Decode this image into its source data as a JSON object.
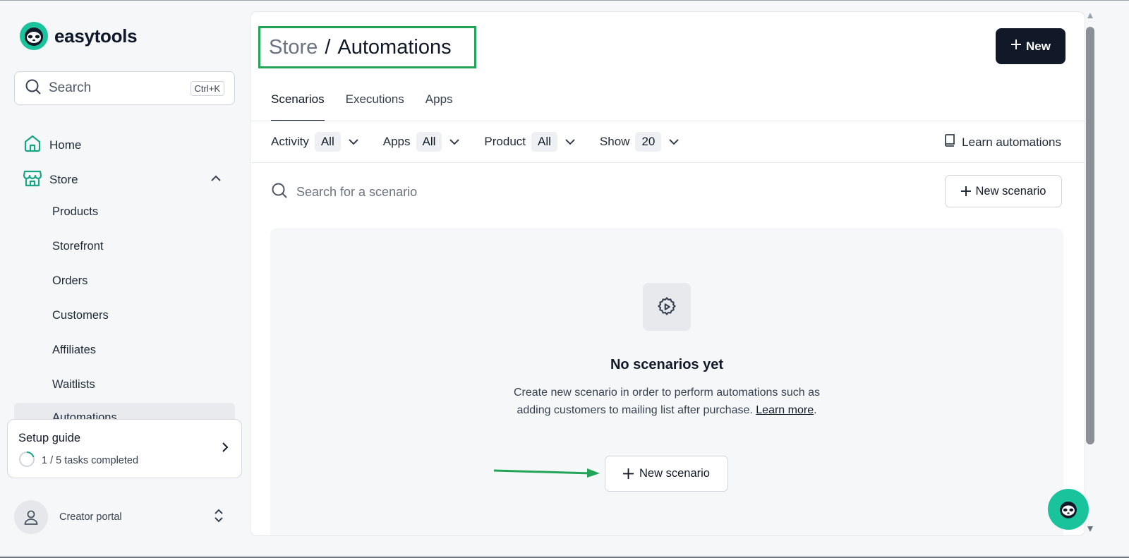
{
  "brand": {
    "name": "easytools",
    "accent": "#19c39c"
  },
  "sidebar": {
    "search": {
      "label": "Search",
      "shortcut": "Ctrl+K"
    },
    "items": [
      {
        "label": "Home",
        "icon": "home-icon"
      },
      {
        "label": "Store",
        "icon": "store-icon",
        "expanded": true
      }
    ],
    "store_sub": [
      "Products",
      "Storefront",
      "Orders",
      "Customers",
      "Affiliates",
      "Waitlists",
      "Automations"
    ],
    "setup": {
      "title": "Setup guide",
      "progress": "1 / 5 tasks completed",
      "completed": 1,
      "total": 5
    },
    "portal": {
      "label": "Creator portal"
    }
  },
  "main": {
    "breadcrumb": {
      "parent": "Store",
      "separator": "/",
      "current": "Automations"
    },
    "new_button": "New",
    "tabs": [
      "Scenarios",
      "Executions",
      "Apps"
    ],
    "filters": [
      {
        "label": "Activity",
        "value": "All"
      },
      {
        "label": "Apps",
        "value": "All"
      },
      {
        "label": "Product",
        "value": "All"
      },
      {
        "label": "Show",
        "value": "20"
      }
    ],
    "learn_link": "Learn automations",
    "search_placeholder": "Search for a scenario",
    "new_scenario_label": "New scenario",
    "empty": {
      "title": "No scenarios yet",
      "desc": "Create new scenario in order to perform automations such as adding customers to mailing list after purchase.",
      "link": "Learn more",
      "button": "New scenario"
    }
  },
  "colors": {
    "highlight": "#22a559",
    "dark": "#111827"
  }
}
